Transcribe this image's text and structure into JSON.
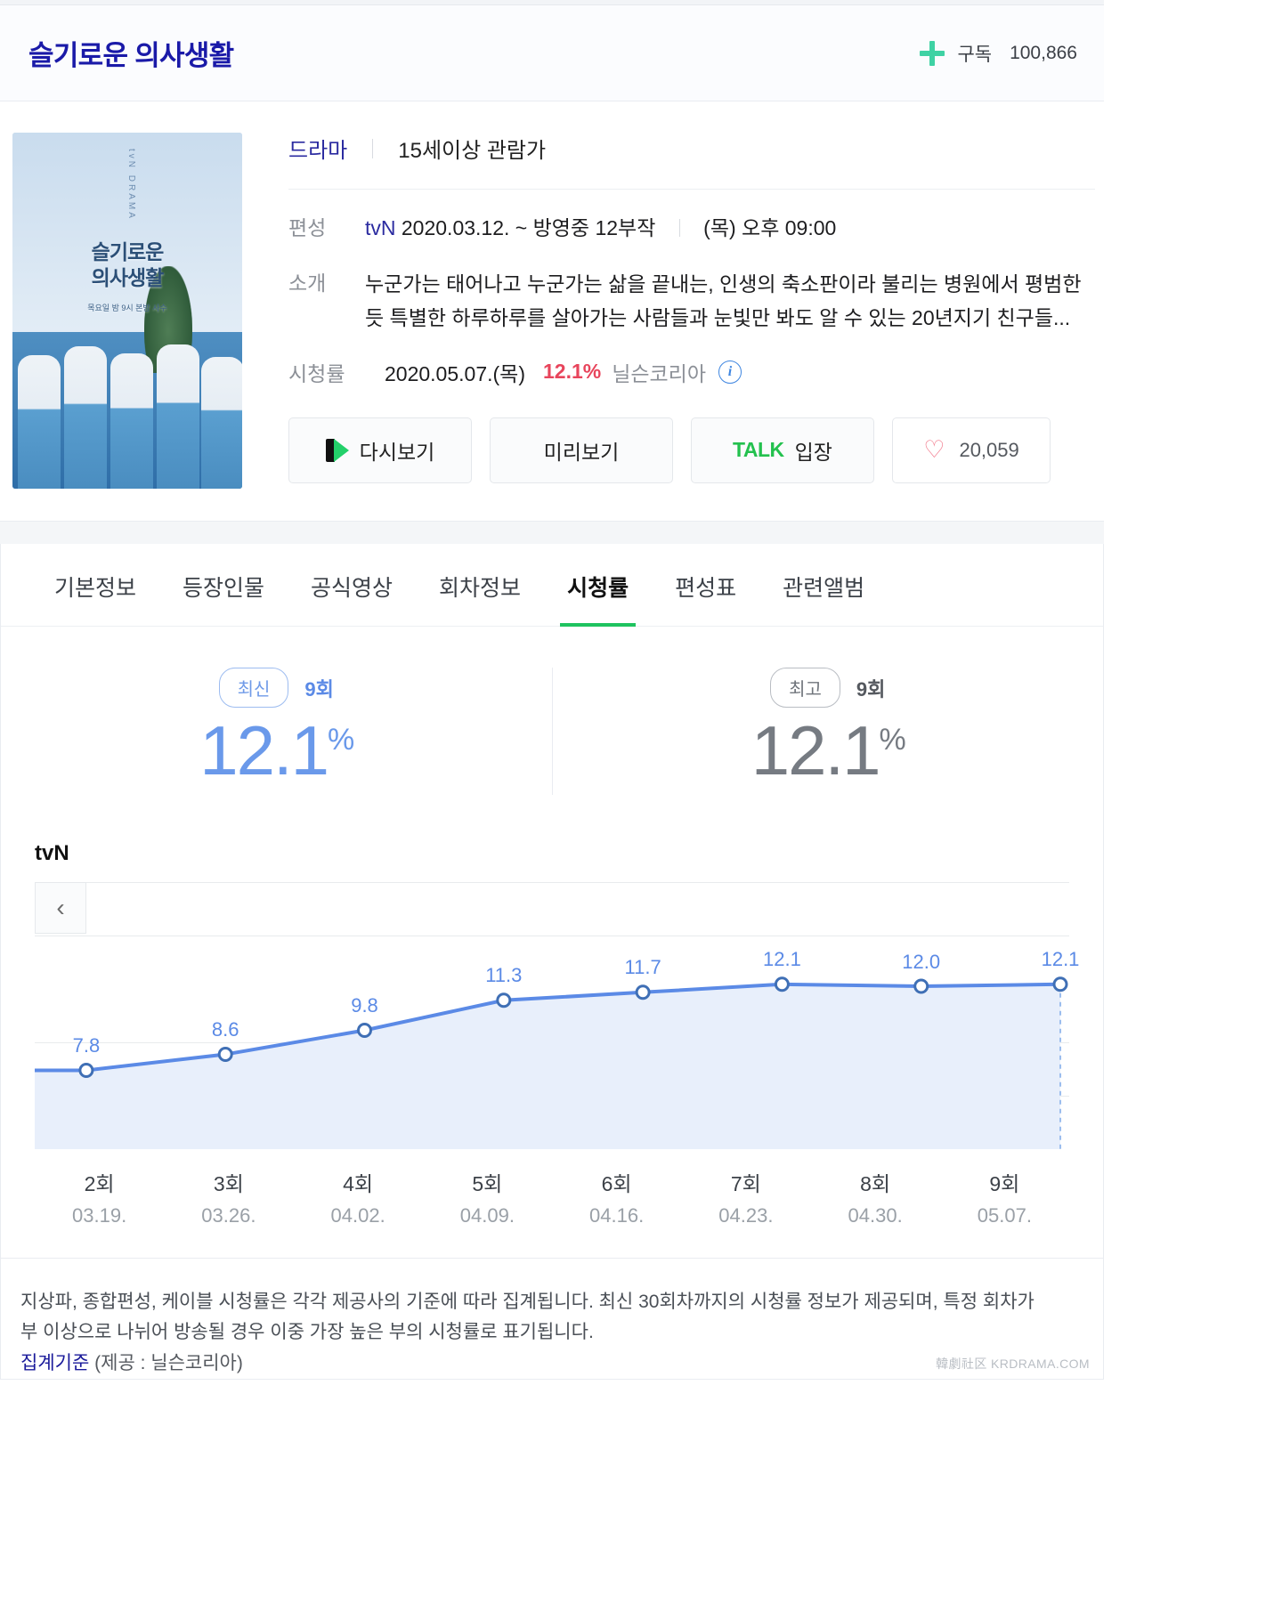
{
  "header": {
    "title": "슬기로운 의사생활",
    "subscribe_label": "구독",
    "subscribe_count": "100,866",
    "plus_icon": "plus-icon",
    "accent_green": "#3fd2a4"
  },
  "poster": {
    "title_line1": "슬기로운",
    "title_line2": "의사생활",
    "caption": "목요일 밤 9시 본방 사수",
    "vertical_text": "tvN DRAMA"
  },
  "info": {
    "genre": "드라마",
    "rating_label": "15세이상 관람가",
    "schedule_key": "편성",
    "channel": "tvN",
    "schedule_value": "2020.03.12. ~ 방영중 12부작",
    "airtime": "(목) 오후 09:00",
    "summary_key": "소개",
    "summary_line1": "누군가는 태어나고 누군가는 삶을 끝내는, 인생의 축소판이라 불리는 병원에서 평범한",
    "summary_line2": "듯 특별한 하루하루를 살아가는 사람들과 눈빛만 봐도 알 수 있는 20년지기 친구들...",
    "rating_key": "시청률",
    "rating_date": "2020.05.07.(목)",
    "rating_percent": "12.1%",
    "rating_source": "닐슨코리아",
    "rating_percent_color": "#e8455c",
    "info_icon": "info-icon"
  },
  "actions": [
    {
      "id": "replay",
      "label": "다시보기",
      "icon": "series-play-icon"
    },
    {
      "id": "preview",
      "label": "미리보기",
      "icon": null
    },
    {
      "id": "talk",
      "label": "입장",
      "brand": "TALK",
      "icon": "talk-icon"
    },
    {
      "id": "like",
      "label": "20,059",
      "icon": "heart-icon"
    }
  ],
  "tabs": [
    {
      "label": "기본정보",
      "active": false
    },
    {
      "label": "등장인물",
      "active": false
    },
    {
      "label": "공식영상",
      "active": false
    },
    {
      "label": "회차정보",
      "active": false
    },
    {
      "label": "시청률",
      "active": true
    },
    {
      "label": "편성표",
      "active": false
    },
    {
      "label": "관련앨범",
      "active": false
    }
  ],
  "summary": {
    "latest": {
      "badge": "최신",
      "episode": "9회",
      "value": "12.1",
      "unit": "%",
      "color": "#6a99ea"
    },
    "highest": {
      "badge": "최고",
      "episode": "9회",
      "value": "12.1",
      "unit": "%",
      "color": "#767b82"
    }
  },
  "chart_data": {
    "type": "line",
    "title": "",
    "channel": "tvN",
    "categories": [
      "2회",
      "3회",
      "4회",
      "5회",
      "6회",
      "7회",
      "8회",
      "9회"
    ],
    "tick_dates": [
      "03.19.",
      "03.26.",
      "04.02.",
      "04.09.",
      "04.16.",
      "04.23.",
      "04.30.",
      "05.07."
    ],
    "values": [
      7.8,
      8.6,
      9.8,
      11.3,
      11.7,
      12.1,
      12.0,
      12.1
    ],
    "point_labels": [
      "7.8",
      "8.6",
      "9.8",
      "11.3",
      "11.7",
      "12.1",
      "12.0",
      "12.1"
    ],
    "series": [
      {
        "name": "tvN",
        "values": [
          7.8,
          8.6,
          9.8,
          11.3,
          11.7,
          12.1,
          12.0,
          12.1
        ]
      }
    ],
    "ylim": [
      0,
      14
    ],
    "xlabel": "",
    "ylabel": "",
    "grid": true,
    "legend": "none",
    "line_color": "#5b8ae6",
    "area_color": "#e8effb",
    "label_color": "#5b8ae6",
    "prev_button": "‹"
  },
  "footnote": {
    "line1": "지상파, 종합편성, 케이블 시청률은 각각 제공사의 기준에 따라 집계됩니다. 최신 30회차까지의 시청률 정보가 제공되며, 특정 회차가",
    "line2": "부 이상으로 나뉘어 방송될 경우 이중 가장 높은 부의 시청률로 표기됩니다.",
    "standard_link": "집계기준",
    "standard_note": "(제공 : 닐슨코리아)"
  },
  "watermark": "韓劇社区 KRDRAMA.COM"
}
